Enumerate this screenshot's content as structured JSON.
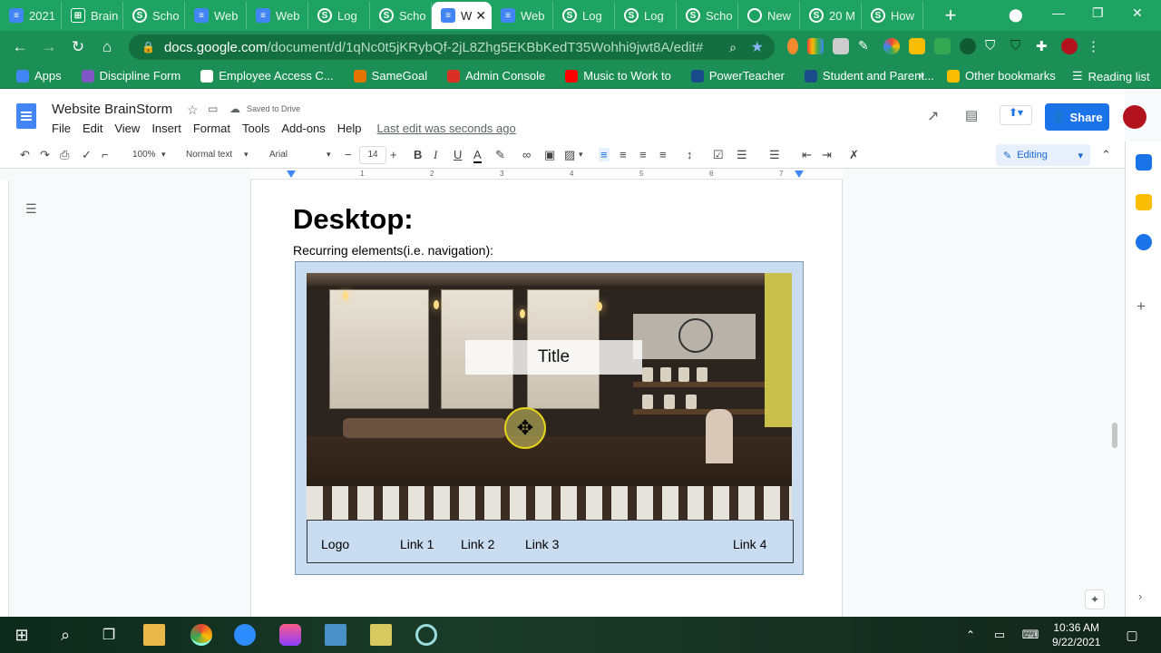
{
  "browser": {
    "tabs": [
      {
        "label": "2021",
        "icon": "docs"
      },
      {
        "label": "Brain",
        "icon": "sheets"
      },
      {
        "label": "Scho",
        "icon": "school"
      },
      {
        "label": "Web",
        "icon": "docs"
      },
      {
        "label": "Web",
        "icon": "docs"
      },
      {
        "label": "Log",
        "icon": "school"
      },
      {
        "label": "Scho",
        "icon": "school"
      },
      {
        "label": "W",
        "icon": "docs",
        "active": true
      },
      {
        "label": "Web",
        "icon": "docs"
      },
      {
        "label": "Log",
        "icon": "school"
      },
      {
        "label": "Log",
        "icon": "school"
      },
      {
        "label": "Scho",
        "icon": "school"
      },
      {
        "label": "New",
        "icon": "news"
      },
      {
        "label": "20 M",
        "icon": "school"
      },
      {
        "label": "How",
        "icon": "school"
      }
    ],
    "new_tab_symbol": "+",
    "url_domain": "docs.google.com",
    "url_path": "/document/d/1qNc0t5jKRybQf-2jL8Zhg5EKBbKedT35Wohhi9jwt8A/edit#",
    "bookmarks": [
      {
        "label": "Apps",
        "color": "#4285f4"
      },
      {
        "label": "Discipline Form",
        "color": "#7e57c2"
      },
      {
        "label": "Employee Access C...",
        "color": "#ffffff"
      },
      {
        "label": "SameGoal",
        "color": "#e37400"
      },
      {
        "label": "Admin Console",
        "color": "#d93025"
      },
      {
        "label": "Music to Work to",
        "color": "#ff0000"
      },
      {
        "label": "PowerTeacher",
        "color": "#1a4c8b"
      },
      {
        "label": "Student and Parent...",
        "color": "#1a4c8b"
      }
    ],
    "bookmarks_overflow": "»",
    "other_bookmarks": "Other bookmarks",
    "reading_list": "Reading list"
  },
  "docs": {
    "title": "Website BrainStorm",
    "saved_status": "Saved to Drive",
    "menu": [
      "File",
      "Edit",
      "View",
      "Insert",
      "Format",
      "Tools",
      "Add-ons",
      "Help"
    ],
    "last_edit": "Last edit was seconds ago",
    "share_label": "Share",
    "toolbar": {
      "zoom": "100%",
      "style": "Normal text",
      "font": "Arial",
      "font_size": "14",
      "mode": "Editing"
    },
    "ruler_marks": [
      "1",
      "2",
      "3",
      "4",
      "5",
      "6",
      "7"
    ]
  },
  "document": {
    "heading": "Desktop:",
    "subline": "Recurring elements(i.e. navigation):",
    "mockup": {
      "title_label": "Title",
      "nav": {
        "logo": "Logo",
        "link1": "Link 1",
        "link2": "Link 2",
        "link3": "Link 3",
        "link4": "Link 4"
      }
    }
  },
  "taskbar": {
    "time": "10:36 AM",
    "date": "9/22/2021"
  },
  "colors": {
    "tab_bar": "#1ea362",
    "address_bar": "#1b8f55",
    "accent_blue": "#1a73e8",
    "mockup_bg": "#c9dcf0"
  }
}
